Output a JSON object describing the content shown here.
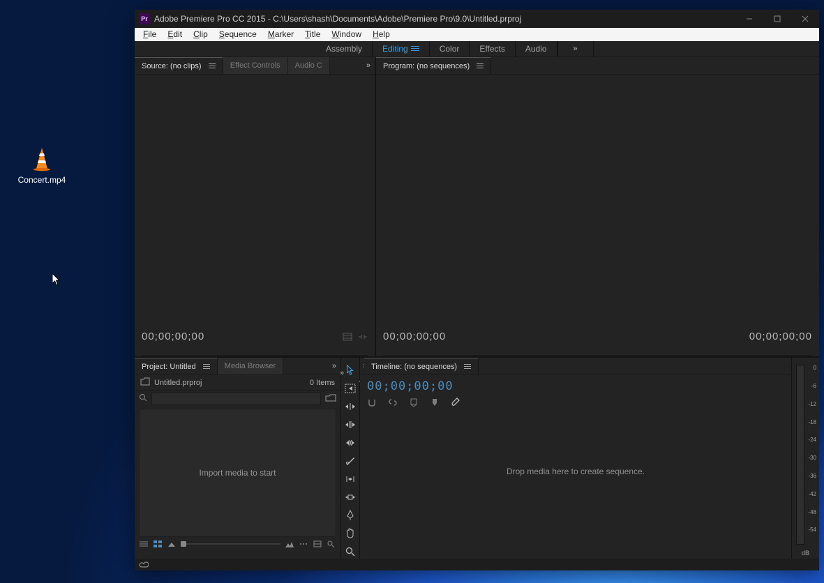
{
  "desktop": {
    "file_label": "Concert.mp4"
  },
  "window": {
    "title": "Adobe Premiere Pro CC 2015 - C:\\Users\\shash\\Documents\\Adobe\\Premiere Pro\\9.0\\Untitled.prproj",
    "app_badge": "Pr"
  },
  "menubar": [
    "File",
    "Edit",
    "Clip",
    "Sequence",
    "Marker",
    "Title",
    "Window",
    "Help"
  ],
  "workspaces": {
    "items": [
      "Assembly",
      "Editing",
      "Color",
      "Effects",
      "Audio"
    ],
    "active_index": 1
  },
  "source_panel": {
    "tabs": [
      "Source: (no clips)",
      "Effect Controls",
      "Audio C"
    ],
    "active_index": 0,
    "timecode": "00;00;00;00"
  },
  "program_panel": {
    "tabs": [
      "Program: (no sequences)"
    ],
    "timecode_left": "00;00;00;00",
    "timecode_right": "00;00;00;00"
  },
  "project_panel": {
    "tabs": [
      "Project: Untitled",
      "Media Browser"
    ],
    "active_index": 0,
    "project_file": "Untitled.prproj",
    "item_count": "0 Items",
    "search_placeholder": "",
    "empty_hint": "Import media to start"
  },
  "timeline_panel": {
    "tab": "Timeline: (no sequences)",
    "timecode": "00;00;00;00",
    "drop_hint": "Drop media here to create sequence."
  },
  "meters": {
    "ticks": [
      "0",
      "-6",
      "-12",
      "-18",
      "-24",
      "-30",
      "-36",
      "-42",
      "-48",
      "-54"
    ],
    "unit": "dB"
  },
  "tools": [
    "selection",
    "track-select",
    "ripple-edit",
    "rolling-edit",
    "rate-stretch",
    "razor",
    "slip",
    "slide",
    "pen",
    "hand",
    "zoom"
  ]
}
